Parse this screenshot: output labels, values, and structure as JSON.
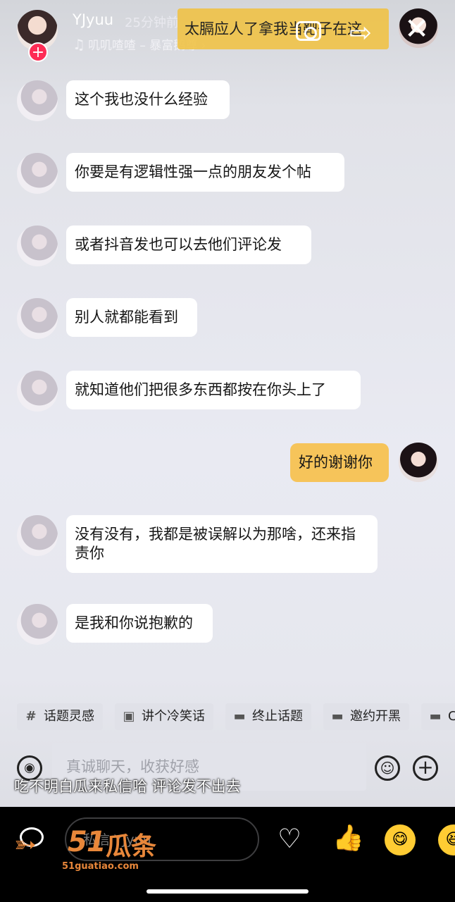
{
  "header": {
    "username": "YJyuu",
    "time": "25分钟前",
    "music_text": "叽叽喳喳 – 暴富鹅尊",
    "music_chevron": "›",
    "danmaku": "太膈应人了拿我当靶子在这",
    "share_icon": "⇨",
    "close_icon": "✕",
    "plus_badge": "+"
  },
  "messages": [
    {
      "side": "left",
      "text": "这个我也没什么经验"
    },
    {
      "side": "left",
      "text": "你要是有逻辑性强一点的朋友发个帖"
    },
    {
      "side": "left",
      "text": "或者抖音发也可以去他们评论发"
    },
    {
      "side": "left",
      "text": "别人就都能看到"
    },
    {
      "side": "left",
      "text": "就知道他们把很多东西都按在你头上了"
    },
    {
      "side": "right",
      "text": "好的谢谢你"
    },
    {
      "side": "left",
      "text": "没有没有，我都是被误解以为那啥，还来指责你"
    },
    {
      "side": "left",
      "text": "是我和你说抱歉的"
    }
  ],
  "suggestions": [
    {
      "icon": "#",
      "label": "话题灵感"
    },
    {
      "icon": "▣",
      "label": "讲个冷笑话"
    },
    {
      "icon": "▬",
      "label": "终止话题"
    },
    {
      "icon": "▬",
      "label": "邀约开黑"
    },
    {
      "icon": "▬",
      "label": "C"
    }
  ],
  "input": {
    "placeholder": "真诚聊天，收获好感",
    "voice_icon": "◉",
    "emoji_icon": "☺",
    "plus_icon": "+"
  },
  "overlay_caption": "吃不明白瓜来私信哈 评论发不出去",
  "bottom": {
    "dm_placeholder": "私信 YJyuu",
    "heart_icon": "♡",
    "thumb_icon": "👍",
    "emoji1": "😋",
    "emoji2": "😆"
  },
  "watermark": {
    "brand": "51",
    "brand_cn": "瓜条",
    "url": "51guatiao.com",
    "color": "#e8873a"
  }
}
